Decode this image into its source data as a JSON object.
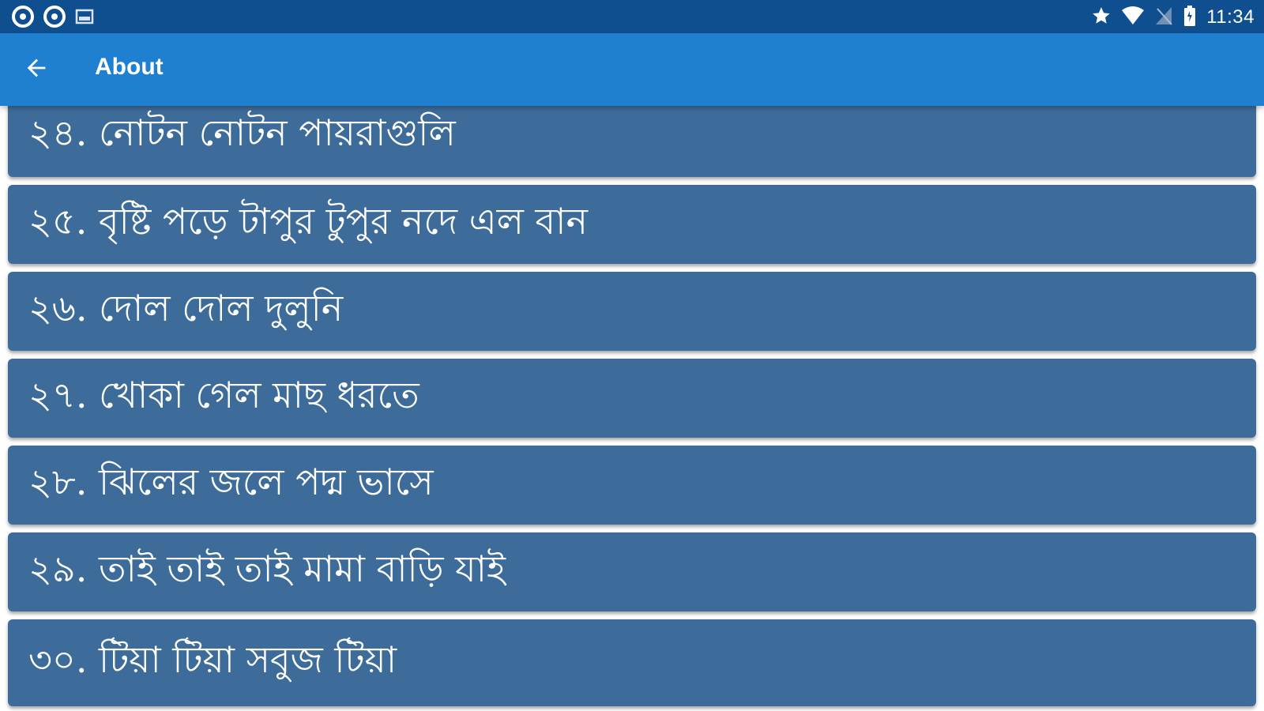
{
  "status_bar": {
    "time": "11:34",
    "left_icons": [
      "circle-app-icon",
      "circle-app-icon",
      "image-icon"
    ],
    "right_icons": [
      "star-icon",
      "wifi-icon",
      "no-signal-icon",
      "battery-icon"
    ]
  },
  "app_bar": {
    "back_icon": "arrow-left-icon",
    "title": "About",
    "color": "#1f7fd0"
  },
  "list": {
    "card_color": "#3d6c9a",
    "items": [
      {
        "label": "২৪. নোটন নোটন পায়রাগুলি"
      },
      {
        "label": "২৫. বৃষ্টি পড়ে টাপুর টুপুর নদে এল বান"
      },
      {
        "label": "২৬. দোল দোল দুলুনি"
      },
      {
        "label": "২৭. খোকা গেল মাছ ধরতে"
      },
      {
        "label": "২৮. ঝিলের জলে পদ্ম ভাসে"
      },
      {
        "label": "২৯. তাই তাই তাই মামা বাড়ি যাই"
      },
      {
        "label": "৩০. টিয়া টিয়া সবুজ টিয়া"
      }
    ]
  }
}
